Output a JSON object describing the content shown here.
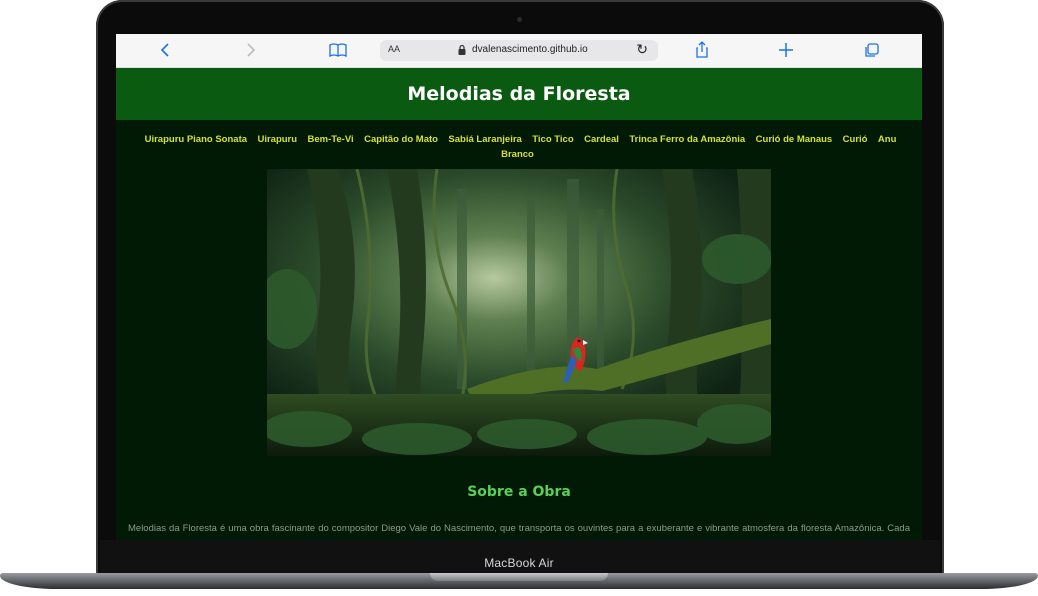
{
  "device": {
    "label": "MacBook Air"
  },
  "browser": {
    "text_size_label": "AA",
    "url": "dvalenascimento.github.io",
    "icons": [
      "chevron-left-icon",
      "chevron-right-icon",
      "book-icon",
      "lock-icon",
      "reload-icon",
      "share-icon",
      "plus-icon",
      "tabs-icon"
    ],
    "accent": "#1a73e8"
  },
  "site": {
    "title": "Melodias da Floresta",
    "header_color": "#0b5a12",
    "background_color": "#001a05",
    "nav": [
      "Uirapuru Piano Sonata",
      "Uirapuru",
      "Bem-Te-Vi",
      "Capitão do Mato",
      "Sabiá Laranjeira",
      "Tico Tico",
      "Cardeal",
      "Trinca Ferro da Amazônia",
      "Curió de Manaus",
      "Curió",
      "Anu Branco"
    ],
    "nav_color": "#d8e030",
    "about": {
      "title": "Sobre a Obra",
      "text": "Melodias da Floresta é uma obra fascinante do compositor Diego Vale do Nascimento, que transporta os ouvintes para a exuberante e vibrante atmosfera da floresta Amazônica. Cada música é uma jornada única, inspirada nos cantos melodiosos dos pássaros nativos da região. Combinando técnica refinada e sensibilidade artística,"
    }
  }
}
